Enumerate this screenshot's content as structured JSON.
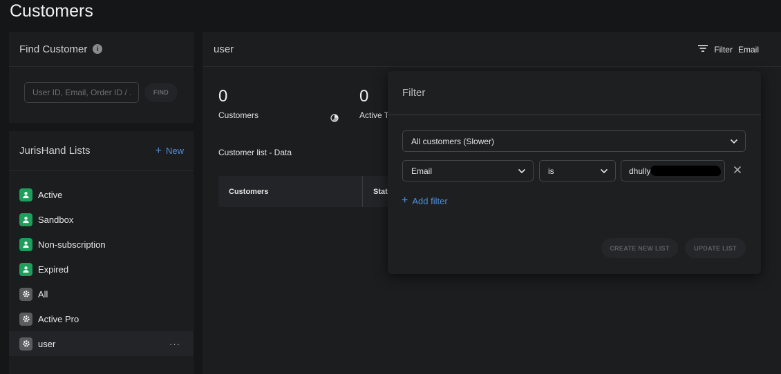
{
  "page": {
    "title": "Customers"
  },
  "find_customer": {
    "title": "Find Customer",
    "info_icon": "info-icon",
    "input_placeholder": "User ID, Email, Order ID / ...",
    "find_label": "FIND"
  },
  "lists": {
    "title": "JurisHand Lists",
    "new_label": "New",
    "items": [
      {
        "label": "Active",
        "icon": "person-icon",
        "color": "#1d9e5a"
      },
      {
        "label": "Sandbox",
        "icon": "person-icon",
        "color": "#1d9e5a"
      },
      {
        "label": "Non-subscription",
        "icon": "person-icon",
        "color": "#1d9e5a"
      },
      {
        "label": "Expired",
        "icon": "person-icon",
        "color": "#1d9e5a"
      },
      {
        "label": "All",
        "icon": "gear-icon",
        "color": "#5b5c60"
      },
      {
        "label": "Active Pro",
        "icon": "gear-icon",
        "color": "#5b5c60"
      },
      {
        "label": "user",
        "icon": "gear-icon",
        "color": "#5b5c60",
        "selected": true,
        "more": "···"
      }
    ]
  },
  "main": {
    "title": "user",
    "filter_toggle": "Filter",
    "filter_field": "Email",
    "stats": [
      {
        "value": "0",
        "label": "Customers"
      },
      {
        "value": "0",
        "label": "Active T"
      }
    ],
    "list_title": "Customer list - Data",
    "table_headers": [
      "Customers",
      "Statu"
    ]
  },
  "filter_popover": {
    "title": "Filter",
    "scope_select": "All customers (Slower)",
    "field_select": "Email",
    "operator_select": "is",
    "value": "dhully",
    "add_filter_label": "Add filter",
    "create_list_label": "CREATE NEW LIST",
    "update_list_label": "UPDATE LIST"
  },
  "colors": {
    "background": "#151618",
    "panel": "#1c1d1f",
    "accent_blue": "#4f8fd8",
    "list_green": "#1d9e5a"
  }
}
